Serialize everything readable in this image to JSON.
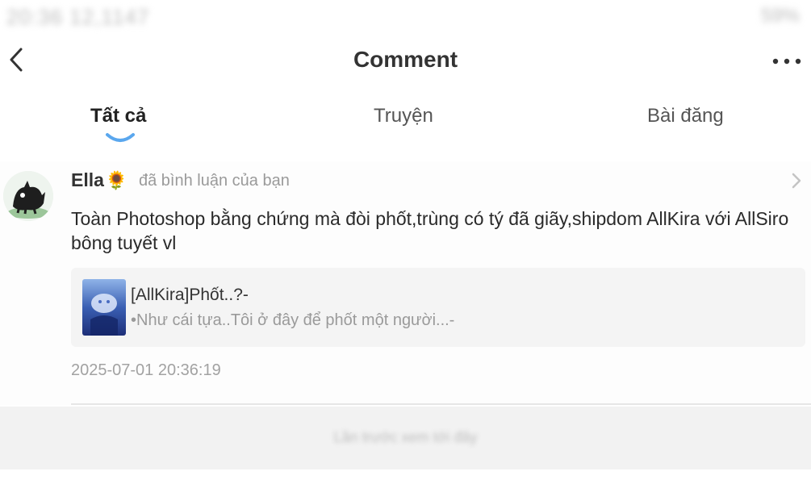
{
  "status_bar": {
    "time": "20:36 12,1147",
    "indicators": "59%"
  },
  "header": {
    "title": "Comment",
    "back_icon": "chevron-left-icon",
    "more_icon": "more-horizontal-icon"
  },
  "tabs": [
    {
      "label": "Tất cả",
      "active": true
    },
    {
      "label": "Truyện",
      "active": false
    },
    {
      "label": "Bài đăng",
      "active": false
    }
  ],
  "colors": {
    "accent": "#5aa7ee",
    "text_primary": "#222222",
    "text_secondary": "#9a9a9a",
    "card_bg": "#f4f4f4"
  },
  "comment": {
    "username": "Ella",
    "username_emoji": "🌻",
    "action": "đã bình luận của bạn",
    "text": "Toàn Photoshop bằng chứng mà đòi phốt,trùng có tý đã giãy,shipdom AllKira với AllSiro bông tuyết vl",
    "story": {
      "title": "[AllKira]Phốt..?-",
      "description": "•Như cái tựa..Tôi ở đây để phốt một người...-"
    },
    "timestamp": "2025-07-01 20:36:19"
  },
  "footer": {
    "text": "Lần trước xem tới đây"
  }
}
